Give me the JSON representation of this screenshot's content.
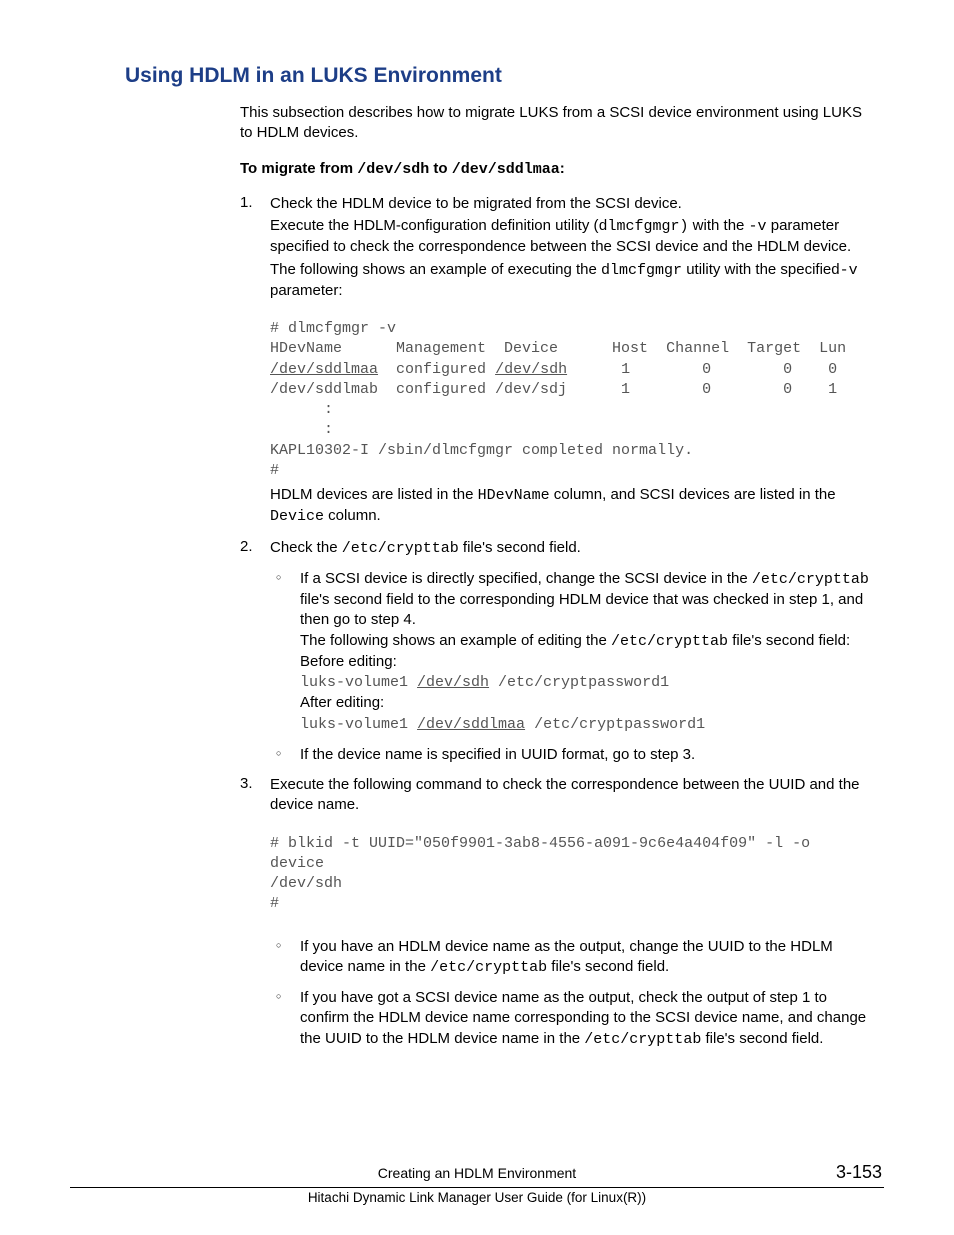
{
  "heading": "Using HDLM in an LUKS Environment",
  "intro": "This subsection describes how to migrate LUKS from a SCSI device environment using LUKS to HDLM devices.",
  "migrate_line": {
    "prefix": "To migrate from ",
    "from": "/dev/sdh",
    "mid": " to ",
    "to": "/dev/sddlmaa",
    "suffix": ":"
  },
  "step1": {
    "num": "1.",
    "p1": "Check the HDLM device to be migrated from the SCSI device.",
    "p2a": "Execute the HDLM-configuration definition utility (",
    "p2code1": "dlmcfgmgr)",
    "p2b": " with the ",
    "p2code2": "-v",
    "p2c": " parameter specified to check the correspondence between the SCSI device and the HDLM device.",
    "p3a": "The following shows an example of executing the ",
    "p3code": "dlmcfgmgr",
    "p3b": " utility with the specified",
    "p3code2": "-v",
    "p3c": " parameter:",
    "code_lines": "# dlmcfgmgr -v\nHDevName      Management  Device      Host  Channel  Target  Lun",
    "code_row1_a": "/dev/sddlmaa",
    "code_row1_b": "  configured ",
    "code_row1_c": "/dev/sdh",
    "code_row1_d": "      1        0        0    0",
    "code_row2": "/dev/sddlmab  configured /dev/sdj      1        0        0    1",
    "code_tail": "      :\n      :\nKAPL10302-I /sbin/dlmcfgmgr completed normally.\n#",
    "p4a": "HDLM devices are listed in the ",
    "p4code1": "HDevName",
    "p4b": " column, and SCSI devices are listed in the ",
    "p4code2": "Device",
    "p4c": " column."
  },
  "step2": {
    "num": "2.",
    "p1a": "Check the ",
    "p1code": "/etc/crypttab",
    "p1b": " file's second field.",
    "b1a": "If a SCSI device is directly specified, change the SCSI device in the ",
    "b1code1": "/etc/crypttab",
    "b1b": " file's second field to the corresponding HDLM device that was checked in step 1, and then go to step 4.",
    "b1c": "The following shows an example of editing the ",
    "b1code2": "/etc/crypttab",
    "b1d": " file's second field:",
    "before_label": "Before editing:",
    "before_code_a": "luks-volume1 ",
    "before_code_u": "/dev/sdh",
    "before_code_b": " /etc/cryptpassword1",
    "after_label": "After editing:",
    "after_code_a": "luks-volume1 ",
    "after_code_u": "/dev/sddlmaa",
    "after_code_b": " /etc/cryptpassword1",
    "b2": "If the device name is specified in UUID format, go to step 3."
  },
  "step3": {
    "num": "3.",
    "p1": "Execute the following command to check the correspondence between the UUID and the device name.",
    "code": "# blkid -t UUID=\"050f9901-3ab8-4556-a091-9c6e4a404f09\" -l -o \ndevice\n/dev/sdh\n#",
    "b1a": "If you have an HDLM device name as the output, change the UUID to the HDLM device name in the ",
    "b1code": "/etc/crypttab",
    "b1b": " file's second field.",
    "b2a": "If you have got a SCSI device name as the output, check the output of step 1 to confirm the HDLM device name corresponding to the SCSI device name, and change the UUID to the HDLM device name in the ",
    "b2code": "/etc/crypttab",
    "b2b": " file's second field."
  },
  "footer": {
    "chapter": "Creating an HDLM Environment",
    "page": "3-153",
    "book": "Hitachi Dynamic Link Manager User Guide (for Linux(R))"
  }
}
